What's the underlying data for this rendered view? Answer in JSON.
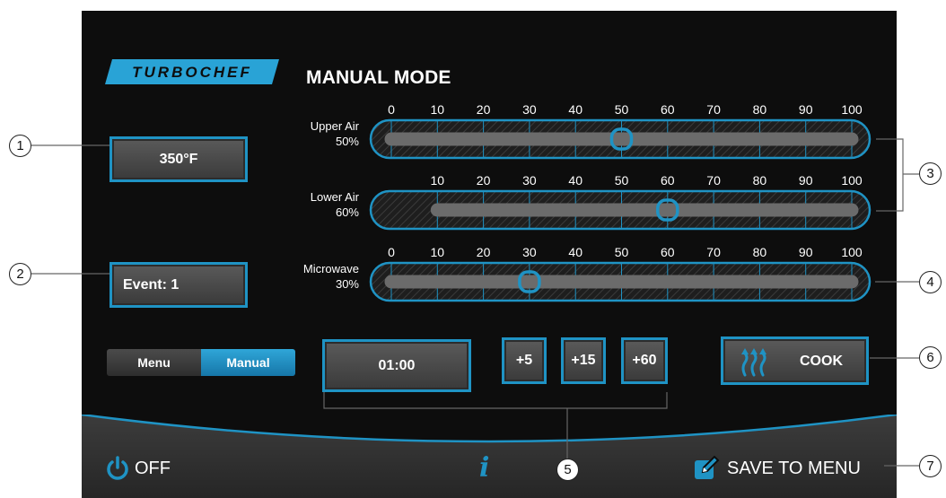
{
  "app": {
    "brand": "TURBOCHEF",
    "mode_title": "MANUAL MODE"
  },
  "temperature": {
    "label": "350°F"
  },
  "event": {
    "label": "Event: 1"
  },
  "mode_toggle": {
    "options": [
      "Menu",
      "Manual"
    ],
    "selected": "Manual"
  },
  "sliders": [
    {
      "name": "Upper Air",
      "value_label": "50%",
      "value": 50,
      "min": 0,
      "scale_labels": [
        "0",
        "10",
        "20",
        "30",
        "40",
        "50",
        "60",
        "70",
        "80",
        "90",
        "100"
      ]
    },
    {
      "name": "Lower Air",
      "value_label": "60%",
      "value": 60,
      "min": 10,
      "scale_labels": [
        "10",
        "20",
        "30",
        "40",
        "50",
        "60",
        "70",
        "80",
        "90",
        "100"
      ]
    },
    {
      "name": "Microwave",
      "value_label": "30%",
      "value": 30,
      "min": 0,
      "scale_labels": [
        "0",
        "10",
        "20",
        "30",
        "40",
        "50",
        "60",
        "70",
        "80",
        "90",
        "100"
      ]
    }
  ],
  "timer": {
    "value": "01:00",
    "increments": [
      "+5",
      "+15",
      "+60"
    ]
  },
  "cook": {
    "label": "COOK",
    "icon": "heat-waves-icon"
  },
  "footer": {
    "off_label": "OFF",
    "off_icon": "power-icon",
    "info_icon": "info-icon",
    "save_label": "SAVE TO MENU",
    "save_icon": "edit-icon"
  },
  "callouts": [
    "1",
    "2",
    "3",
    "4",
    "5",
    "6",
    "7"
  ],
  "colors": {
    "accent": "#1f93c4",
    "background": "#0d0d0d",
    "track": "#6b6b6b"
  }
}
